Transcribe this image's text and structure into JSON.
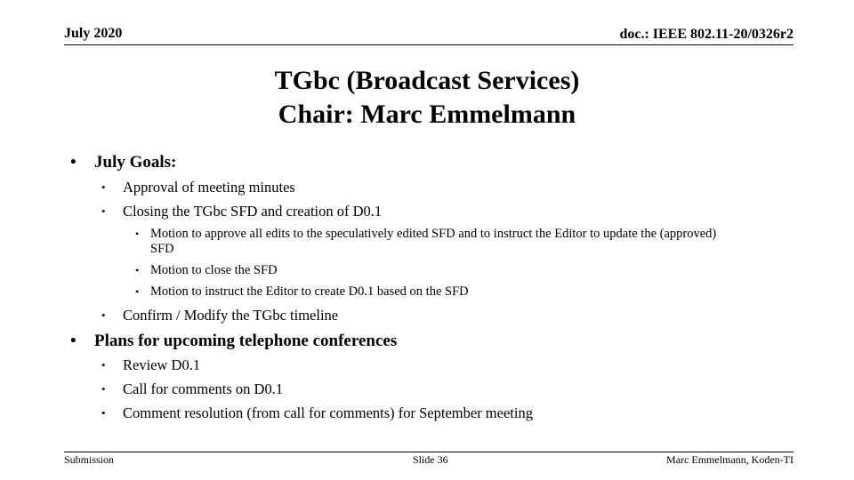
{
  "header": {
    "date": "July 2020",
    "doc_id": "doc.: IEEE 802.11-20/0326r2"
  },
  "title": {
    "line1": "TGbc (Broadcast Services)",
    "line2": "Chair: Marc Emmelmann"
  },
  "content": {
    "sections": [
      {
        "label": "July Goals:",
        "items": [
          {
            "label": "Approval of meeting minutes"
          },
          {
            "label": "Closing the TGbc SFD and creation of D0.1",
            "subitems": [
              {
                "label": "Motion to approve all edits to the speculatively edited SFD and to instruct the Editor to update the (approved)",
                "cont": "SFD"
              },
              {
                "label": "Motion to close the SFD"
              },
              {
                "label": "Motion to instruct the Editor to create D0.1 based on the SFD"
              }
            ]
          },
          {
            "label": "Confirm / Modify the TGbc timeline"
          }
        ]
      },
      {
        "label": "Plans for upcoming telephone conferences",
        "items": [
          {
            "label": "Review D0.1"
          },
          {
            "label": "Call for comments on D0.1"
          },
          {
            "label": "Comment resolution (from call for comments) for September meeting"
          }
        ]
      }
    ],
    "bullet_char": "•"
  },
  "footer": {
    "left": "Submission",
    "center": "Slide 36",
    "right": "Marc Emmelmann, Koden-TI"
  }
}
